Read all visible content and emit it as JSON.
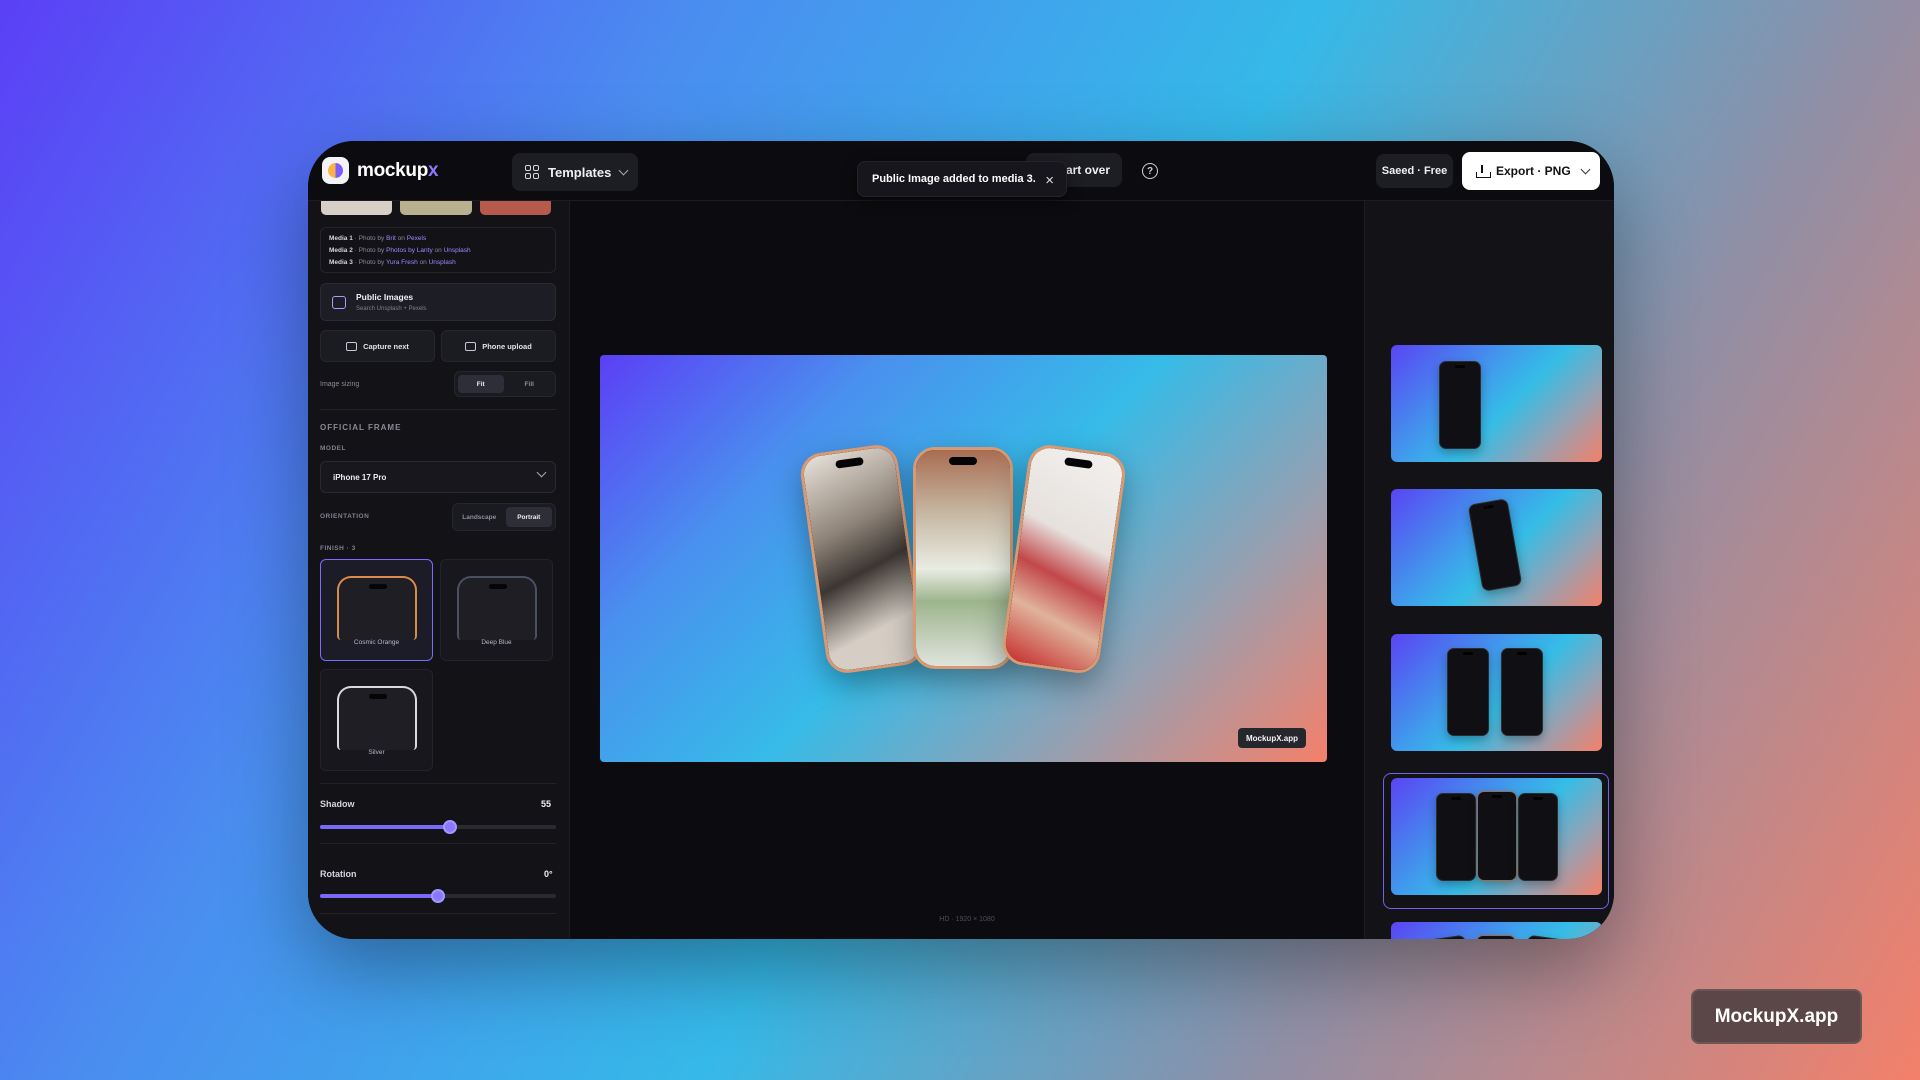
{
  "app": {
    "logo_main": "mockup",
    "logo_accent": "x"
  },
  "header": {
    "templates_label": "Templates",
    "start_over_label": "tart over",
    "user_label": "Saeed · Free",
    "export_label": "Export · PNG"
  },
  "toast": {
    "message": "Public Image added to media 3.",
    "close": "×"
  },
  "credits": [
    {
      "media": "Media 1",
      "t1": " · Photo by ",
      "author": "Brit",
      "t2": " on ",
      "source": "Pexels"
    },
    {
      "media": "Media 2",
      "t1": " · Photo by ",
      "author": "Photos by Lanty",
      "t2": " on ",
      "source": "Unsplash"
    },
    {
      "media": "Media 3",
      "t1": " · Photo by ",
      "author": "Yura Fresh",
      "t2": " on ",
      "source": "Unsplash"
    }
  ],
  "public_images": {
    "title": "Public Images",
    "subtitle": "Search Unsplash + Pexels"
  },
  "buttons": {
    "capture": "Capture next",
    "phone_upload": "Phone upload"
  },
  "image_sizing": {
    "label": "Image sizing",
    "options": [
      "Fit",
      "Fill"
    ],
    "selected": "Fit"
  },
  "frame": {
    "section_title": "OFFICIAL FRAME",
    "model_label": "MODEL",
    "model_value": "iPhone 17 Pro",
    "orientation_label": "ORIENTATION",
    "orientation_options": [
      "Landscape",
      "Portrait"
    ],
    "orientation_selected": "Portrait",
    "finish_label": "FINISH · 3",
    "finishes": [
      {
        "name": "Cosmic Orange",
        "color": "#d98b4a",
        "selected": true
      },
      {
        "name": "Deep Blue",
        "color": "#4a4f62",
        "selected": false
      },
      {
        "name": "Silver",
        "color": "#d9d9de",
        "selected": false
      }
    ]
  },
  "sliders": {
    "shadow": {
      "label": "Shadow",
      "value": "55",
      "fraction": 0.55
    },
    "rotation": {
      "label": "Rotation",
      "value": "0°",
      "fraction": 0.5
    }
  },
  "canvas": {
    "badge": "MockupX.app",
    "resolution": "HD · 1920 × 1080"
  },
  "templates": [
    {
      "phones": 1,
      "style": "single"
    },
    {
      "phones": 1,
      "style": "tilted"
    },
    {
      "phones": 2,
      "style": "pair"
    },
    {
      "phones": 3,
      "style": "row"
    },
    {
      "phones": 3,
      "style": "fan",
      "selected": true
    },
    {
      "phones": 0,
      "style": "partial"
    }
  ],
  "watermark": "MockupX.app",
  "colors": {
    "accent": "#7b69f7",
    "frame": "#d99a73"
  }
}
